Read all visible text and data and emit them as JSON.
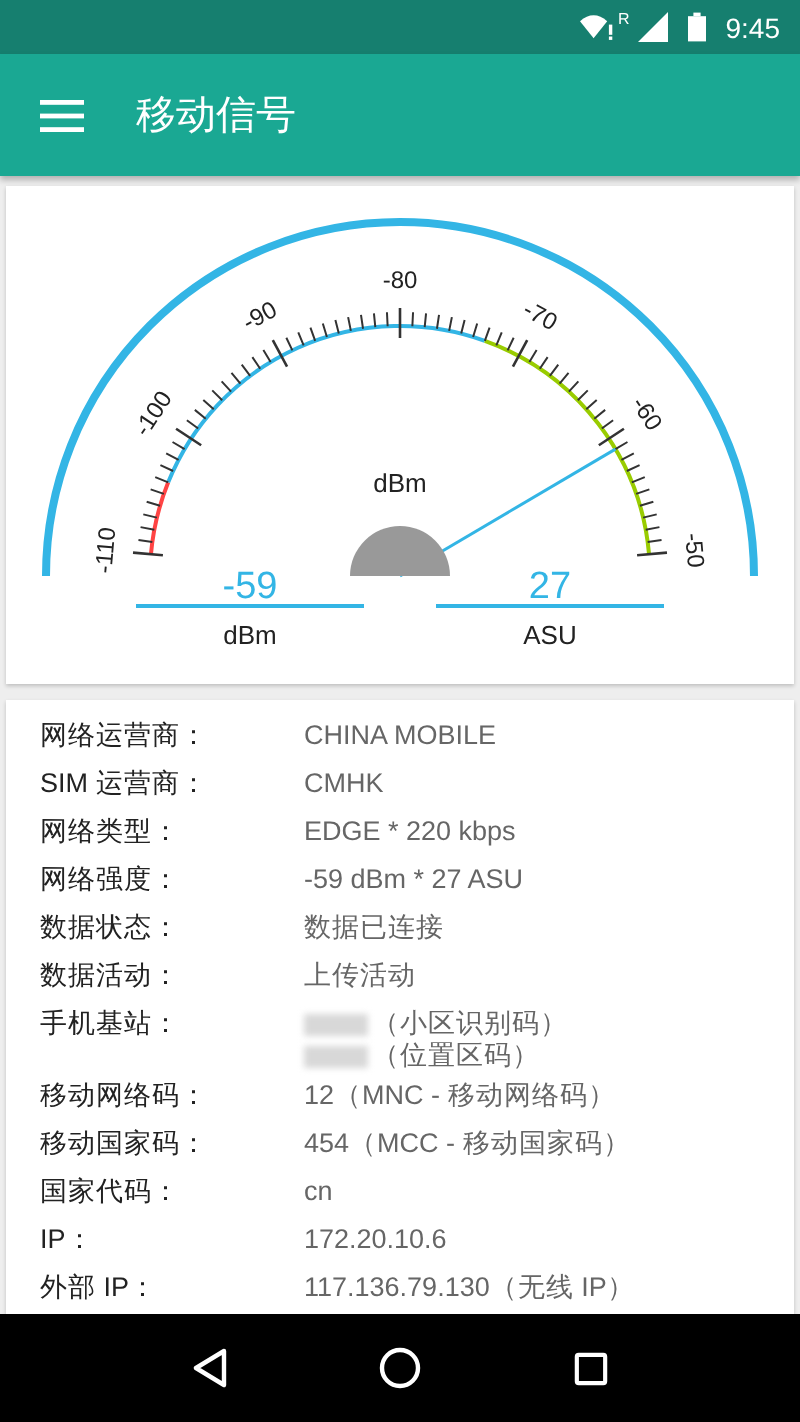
{
  "status_bar": {
    "time": "9:45",
    "roaming": "R"
  },
  "app_bar": {
    "title": "移动信号"
  },
  "gauge": {
    "unit_label": "dBm",
    "ticks": [
      "-110",
      "-100",
      "-90",
      "-80",
      "-70",
      "-60",
      "-50"
    ],
    "readouts": [
      {
        "value": "-59",
        "unit": "dBm"
      },
      {
        "value": "27",
        "unit": "ASU"
      }
    ]
  },
  "info_rows": [
    {
      "label": "网络运营商：",
      "values": [
        "CHINA MOBILE"
      ]
    },
    {
      "label": "SIM 运营商：",
      "values": [
        "CMHK"
      ]
    },
    {
      "label": "网络类型：",
      "values": [
        "EDGE * 220 kbps"
      ]
    },
    {
      "label": "网络强度：",
      "values": [
        "-59 dBm * 27 ASU"
      ]
    },
    {
      "label": "数据状态：",
      "values": [
        "数据已连接"
      ]
    },
    {
      "label": "数据活动：",
      "values": [
        "上传活动"
      ]
    },
    {
      "label": "手机基站：",
      "kind": "blurred",
      "values": [
        "（小区识别码）",
        "（位置区码）"
      ]
    },
    {
      "label": "移动网络码：",
      "values": [
        "12（MNC - 移动网络码）"
      ]
    },
    {
      "label": "移动国家码：",
      "values": [
        "454（MCC - 移动国家码）"
      ]
    },
    {
      "label": "国家代码：",
      "values": [
        "cn"
      ]
    },
    {
      "label": "IP：",
      "values": [
        "172.20.10.6"
      ]
    },
    {
      "label": "外部 IP：",
      "values": [
        "117.136.79.130（无线 IP）"
      ]
    }
  ]
}
